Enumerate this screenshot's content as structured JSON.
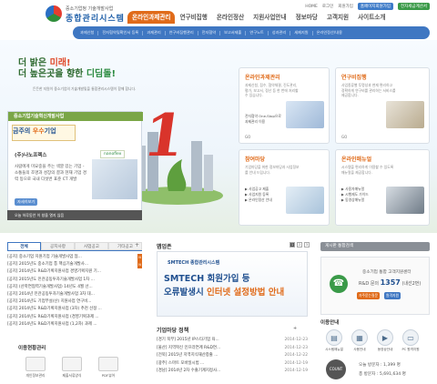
{
  "header": {
    "logo_sub": "중소기업청 기술개발사업",
    "logo_main": "종합관리시스템",
    "util": {
      "home": "HOME",
      "login": "로그인",
      "join": "회원가입",
      "btn_member": "홈페이지회원가입",
      "btn_notice": "전자세금계산서"
    }
  },
  "gnb": [
    "온라인과제관리",
    "연구비집행",
    "온라인정산",
    "지원사업안내",
    "정보마당",
    "고객지원",
    "사이트소개"
  ],
  "subnav": [
    "과제신청",
    "전자협약및확인서 등록",
    "과제관리",
    "연구비집행관리",
    "전자협약",
    "보고서제출",
    "연구노트",
    "성과관리",
    "세제지원",
    "온라인정산/내용"
  ],
  "hero": {
    "line1_a": "더 밝은 ",
    "line1_b": "미래!",
    "line2_a": "더 높은곳을 향한 ",
    "line2_b": "디딤돌!",
    "desc": "든든한 지원이 중소기업의 기술개발및을 통합관리시스템이 함께 합니다.",
    "big_number": "1"
  },
  "award": {
    "head": "중소기업기술혁신개발사업",
    "badge_a": "금주의 ",
    "badge_b": "우수",
    "badge_c": "기업",
    "company": "(주)나노프렉스",
    "company_logo": "nanoflex",
    "desc": "사람에게 미묘중을 주는 색깔 있는 기업 - 소통들의 조명과 성장의 결과 현재 기업 경력 등으로 국내 다섯번 표준 CT 개발",
    "more": "자세히보기",
    "foot": "오늘 하루동안 이 창을 열지 않음"
  },
  "cards": [
    {
      "title": "온라인과제관리",
      "desc": "과제신청, 접수, 협약체결, 진도관리, 평가, 보고서, 정산 등 한 번에 처리할 수 있습니다.",
      "sub": [
        "전자협약 One-Stop으로",
        "과제관리 이용"
      ],
      "go": "GO"
    },
    {
      "title": "연구비집행",
      "desc": "사업종류별 투명성과 현재 편리하고 정확하게 연구비를 관리하는 서비스를 제공합니다.",
      "sub": [],
      "go": "GO"
    },
    {
      "title": "참여마당",
      "desc": "기업마당을 위한 정보마당과 사업정보를 안내 드립니다.",
      "sub": [
        "▶ 사업공고 제출",
        "▶ 사업지원 등록",
        "▶ 온라인정산 안내"
      ],
      "go": ""
    },
    {
      "title": "온라인매뉴얼",
      "desc": "시스템을 편리하게 이용할 수 있도록 매뉴얼을 제공합니다.",
      "sub": [
        "▶ 사용자매뉴얼",
        "▶ 시행제도 가이드",
        "▶ 동영상매뉴얼"
      ],
      "go": ""
    }
  ],
  "notice": {
    "tabs": [
      "전체",
      "공지사항",
      "사업공고",
      "기타공고"
    ],
    "items": [
      {
        "text": "[공지] 중소기업 지원기업 기술개발사업 협...",
        "new": "N"
      },
      {
        "text": "[공지] 2015년도 중소기업 통 핵심기술개발사...",
        "new": "N"
      },
      {
        "text": "[공지] 2014년도 R&D기획지원사업 경영기획지원 기...",
        "new": ""
      },
      {
        "text": "[공지] 2015년도 민관공동투자기술개발사업 1차 ...",
        "new": ""
      },
      {
        "text": "[공지] (산학연협력기술개발사업) 14년도 4월 선...",
        "new": ""
      },
      {
        "text": "[공지] 2014년 민관공동투자기술개발사업 3차 대...",
        "new": ""
      },
      {
        "text": "[공지] 2014년도 기업부설(산) 지원사업 연구비...",
        "new": ""
      },
      {
        "text": "[공지] 2014년도 R&D기획지원사업 (3차) 추천 선정 ...",
        "new": ""
      },
      {
        "text": "[공지] 2014년도 R&D기획지원사업 (경영기획과제 ...",
        "new": ""
      },
      {
        "text": "[공지] 2014년도 R&D기획지원사업 (1,2차) 과제 ...",
        "new": ""
      }
    ],
    "more": "+"
  },
  "quick": {
    "title": "이용현황관리",
    "items": [
      "개인정보관리",
      "제출서류양식",
      "PDF뷰어"
    ]
  },
  "membership": {
    "title": "맵업존",
    "dots": [
      "1",
      "2",
      "3",
      "4",
      "5"
    ],
    "banner_logo": "SMTECH 종합관리시스템",
    "banner_l1": "SMTECH 회원가입 등",
    "banner_l2_a": "오류발생시 ",
    "banner_l2_b": "인터넷 설정방법 안내"
  },
  "policy": {
    "title": "기업마당 정책",
    "more": "+",
    "items": [
      {
        "text": "[경기 북부] 2015년 IP스타기업 육...",
        "date": "2014-12-23"
      },
      {
        "text": "[울산] 지역혁신 인프라연계 R&D연...",
        "date": "2014-12-23"
      },
      {
        "text": "[전북] 2015년 지역지식재산창출 ...",
        "date": "2014-12-22"
      },
      {
        "text": "[광주] 스마트 모바일시범 ...",
        "date": "2014-12-19"
      },
      {
        "text": "[경남] 2014년 2차 수출기계지정사...",
        "date": "2014-12-19"
      }
    ]
  },
  "side": {
    "search": "게시판 통합검색",
    "call_title": "중소기업 통합 고객지원센터",
    "call_prefix": "R&D 문의",
    "call_number": "1357",
    "call_suffix": "(내선2번)",
    "btn_a": "자주묻는질문",
    "btn_b": "원격지원",
    "guide_title": "이용안내",
    "guide": [
      "시스템매뉴얼",
      "사용안내",
      "동영상안내",
      "PC 원격지원"
    ],
    "visit_label": "COUNT",
    "visit_today": "오늘 방문자 : 1,399 명",
    "visit_total": "총 방문자 : 5,691,634 명"
  }
}
